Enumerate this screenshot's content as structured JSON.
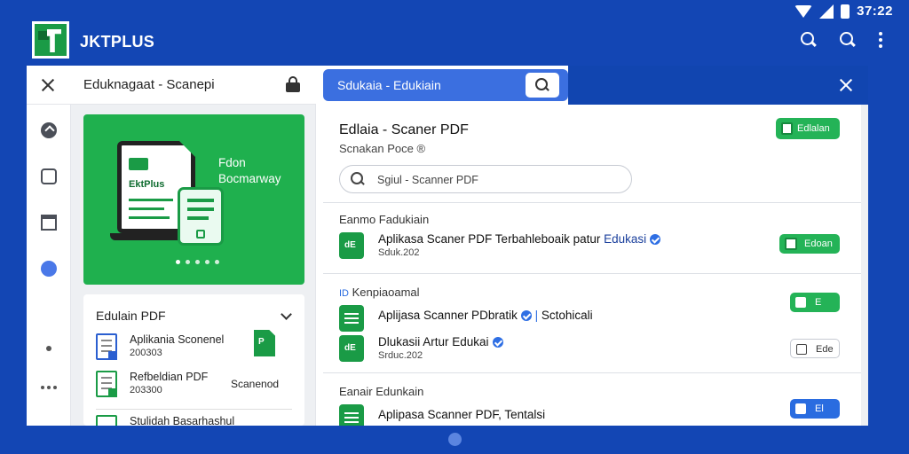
{
  "status": {
    "time": "37:22"
  },
  "app": {
    "title": "JKTPLUS"
  },
  "left_header": {
    "title": "Eduknagaat - Scanepi"
  },
  "search": {
    "query": "Sdukaia - Edukiain"
  },
  "hero": {
    "laptop_label": "EktPlus",
    "line1": "Fdon",
    "line2": "Bocmarway"
  },
  "doc_card": {
    "header": "Edulain PDF",
    "files": [
      {
        "name": "Aplikania Sconenel",
        "meta": "200303"
      },
      {
        "name": "Refbeldian PDF",
        "meta": "203300"
      },
      {
        "name": "Stulidah Basarhashul",
        "meta": ""
      }
    ],
    "side_label": "Scanenod"
  },
  "main": {
    "title": "Edlaia - Scaner PDF",
    "subtitle": "Scnakan Poce ®",
    "badge": "Edlalan",
    "search_placeholder": "Sgiul - Scanner PDF",
    "sections": [
      {
        "label": "Eanmo Fadukiain",
        "rows": [
          {
            "name": "Aplikasa Scaner PDF Terbahleboaik patur",
            "name_hl": "Edukasi",
            "meta": "Sduk.202",
            "action": "Edoan",
            "toggle": "green-filled",
            "icon": "dE"
          }
        ]
      },
      {
        "label": "Kenpiaoamal",
        "rows": [
          {
            "name": "Aplijasa Scanner PDbratik",
            "name_hl": "",
            "after": "Sctohicali",
            "meta": "",
            "action": "E",
            "toggle": "green",
            "icon": "lines"
          },
          {
            "name": "Dlukasii Artur Edukai",
            "name_hl": "",
            "meta": "Srduc.202",
            "action": "Ede",
            "toggle": "outline",
            "icon": "dE"
          }
        ]
      },
      {
        "label": "Eanair Edunkain",
        "rows": [
          {
            "name": "Aplipasa Scanner PDF",
            "name_hl": "",
            "after": "Tentalsi",
            "meta": "",
            "action": "El",
            "toggle": "blue",
            "icon": "lines"
          }
        ]
      }
    ]
  },
  "colors": {
    "background": "#1346b4",
    "accent_green": "#1fb04e",
    "accent_blue": "#2a6ce0"
  },
  "icons": [
    "search-icon",
    "more-icon",
    "close-icon",
    "lock-icon",
    "wifi-icon",
    "signal-icon",
    "battery-icon",
    "verified-icon"
  ]
}
